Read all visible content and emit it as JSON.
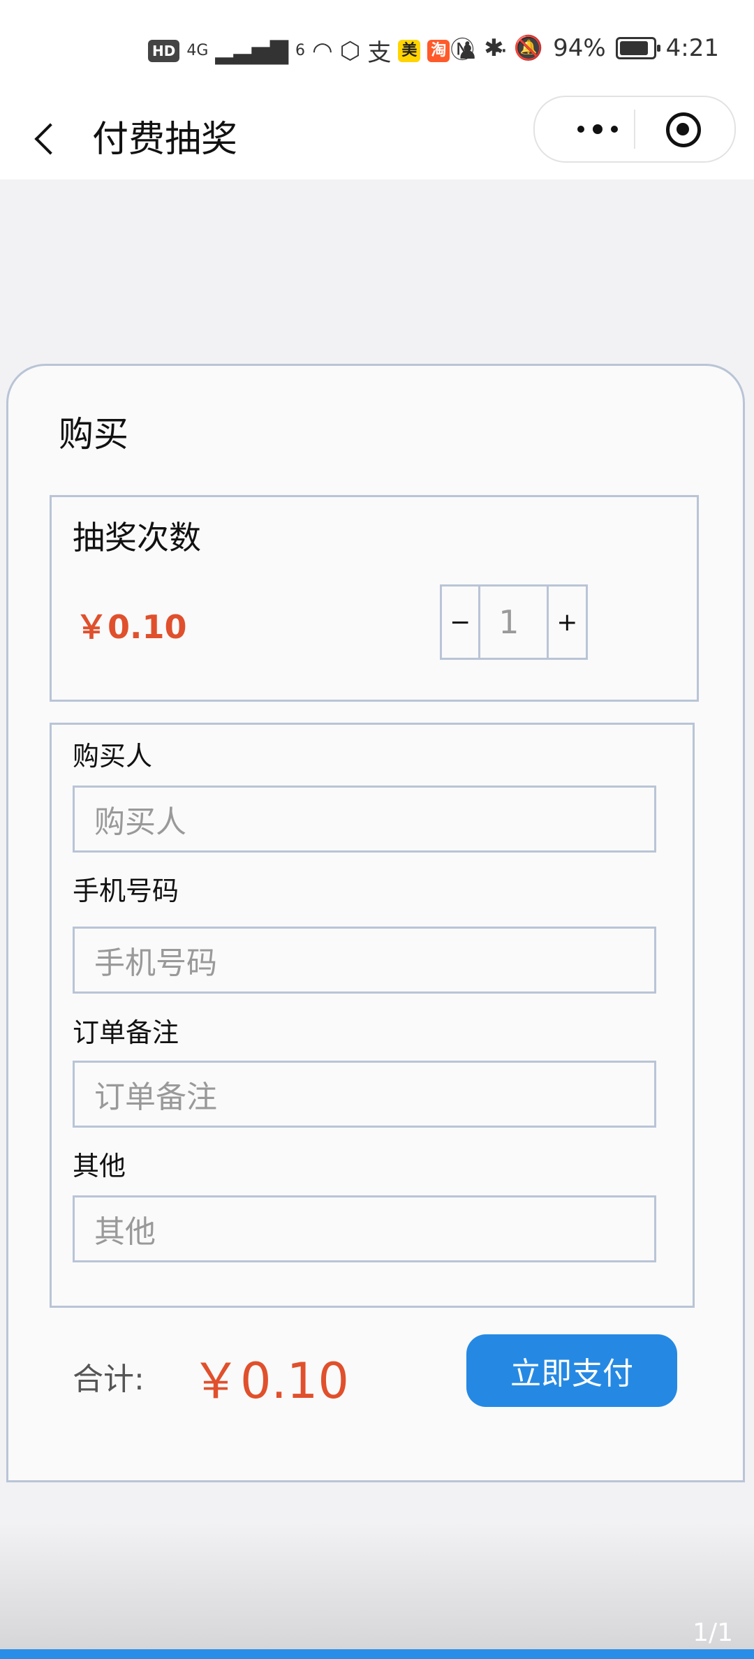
{
  "status_bar": {
    "hd_badge": "HD",
    "network_4g": "4G",
    "signal_small": "6",
    "battery_pct": "94%",
    "time": "4:21",
    "overflow": "···"
  },
  "nav": {
    "title": "付费抽奖"
  },
  "card": {
    "title": "购买",
    "lottery": {
      "title": "抽奖次数",
      "price": "￥0.10",
      "minus": "−",
      "quantity": "1",
      "plus": "+"
    },
    "form": {
      "buyer_label": "购买人",
      "buyer_placeholder": "购买人",
      "phone_label": "手机号码",
      "phone_placeholder": "手机号码",
      "note_label": "订单备注",
      "note_placeholder": "订单备注",
      "other_label": "其他",
      "other_placeholder": "其他"
    },
    "total_label": "合计:",
    "total_amount": "￥0.10",
    "pay_button": "立即支付"
  },
  "page_indicator": "1/1"
}
